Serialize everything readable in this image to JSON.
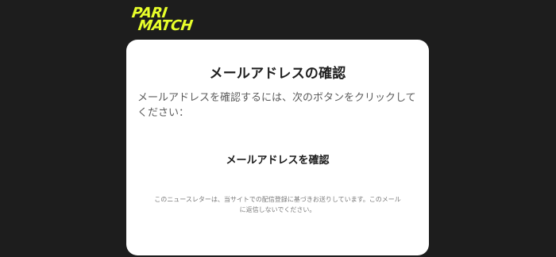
{
  "logo": {
    "line1": "PARI",
    "line2": "MATCH",
    "color": "#e8ff2a"
  },
  "card": {
    "title": "メールアドレスの確認",
    "body": "メールアドレスを確認するには、次のボタンをクリックしてください：",
    "confirm_label": "メールアドレスを確認",
    "footnote": "このニュースレターは、当サイトでの配信登録に基づきお送りしています。このメールに返信しないでください。"
  },
  "colors": {
    "background": "#1d1d1d",
    "card": "#ffffff",
    "accent": "#e8ff2a"
  }
}
